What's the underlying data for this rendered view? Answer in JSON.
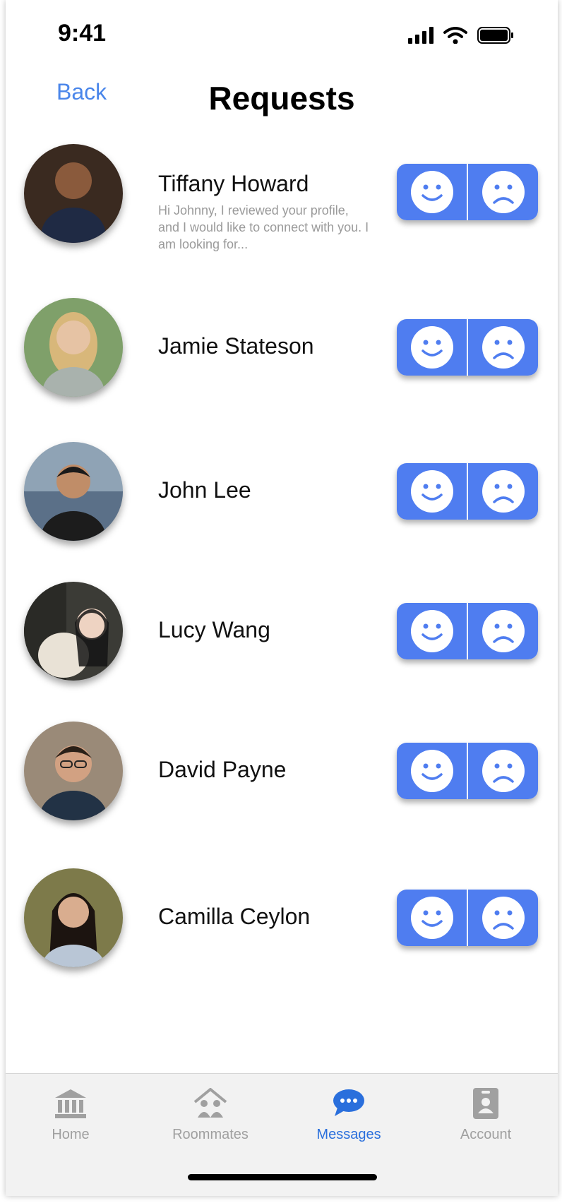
{
  "status": {
    "time": "9:41"
  },
  "header": {
    "back": "Back",
    "title": "Requests"
  },
  "requests": [
    {
      "name": "Tiffany Howard",
      "preview": "Hi  Johnny,  I reviewed your profile, and I would like to connect with you. I am looking for...",
      "avatar_color": "#3a2a20"
    },
    {
      "name": "Jamie Stateson",
      "preview": "",
      "avatar_color": "#c9b48a"
    },
    {
      "name": "John Lee",
      "preview": "",
      "avatar_color": "#2b2b2b"
    },
    {
      "name": "Lucy Wang",
      "preview": "",
      "avatar_color": "#b7a998"
    },
    {
      "name": "David Payne",
      "preview": "",
      "avatar_color": "#4a3a30"
    },
    {
      "name": "Camilla Ceylon",
      "preview": "",
      "avatar_color": "#6b5a3a"
    }
  ],
  "actions": {
    "accept_icon": "smile-face-icon",
    "decline_icon": "sad-face-icon",
    "accent": "#4f7df0"
  },
  "tabs": [
    {
      "label": "Home",
      "icon": "bank-icon",
      "active": false
    },
    {
      "label": "Roommates",
      "icon": "roommates-icon",
      "active": false
    },
    {
      "label": "Messages",
      "icon": "chat-bubble-icon",
      "active": true
    },
    {
      "label": "Account",
      "icon": "account-badge-icon",
      "active": false
    }
  ]
}
